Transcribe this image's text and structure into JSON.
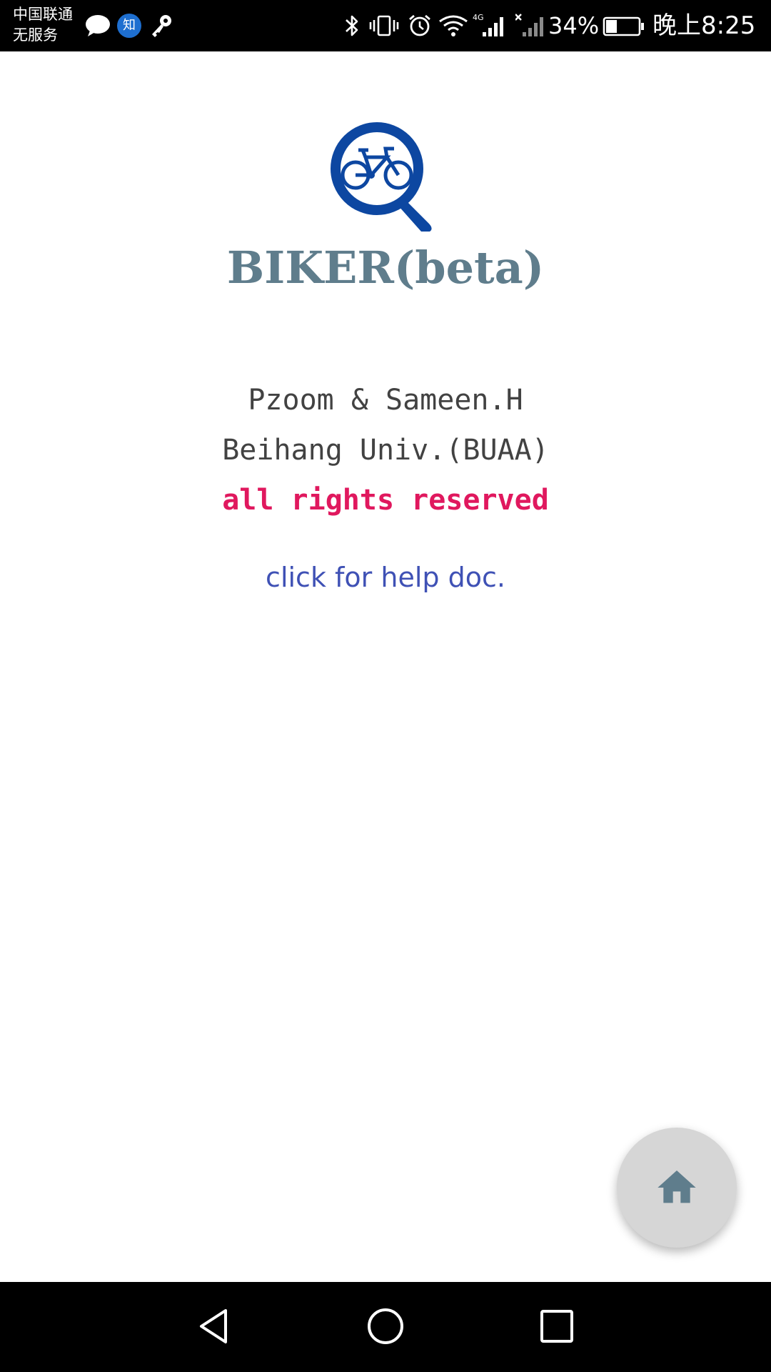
{
  "status_bar": {
    "carrier_line1": "中国联通",
    "carrier_line2": "无服务",
    "notification_icons": [
      "chat-bubble-icon",
      "zhihu-icon",
      "key-icon"
    ],
    "zhihu_label": "知",
    "system_icons": [
      "bluetooth-icon",
      "vibrate-icon",
      "alarm-icon",
      "wifi-icon",
      "signal-4g-icon",
      "signal-no-sim-icon",
      "battery-charging-icon"
    ],
    "signal_4g_label": "4G",
    "battery_percent": "34%",
    "battery_level": 0.34,
    "time": "晚上8:25"
  },
  "app": {
    "logo_icon": "bike-search-icon",
    "title": "BIKER(beta)",
    "authors": "Pzoom & Sameen.H",
    "university": "Beihang Univ.(BUAA)",
    "rights": "all rights reserved",
    "help_link": "click for help doc."
  },
  "fab": {
    "icon": "home-icon"
  },
  "navigation_bar": {
    "buttons": [
      "back-icon",
      "home-circle-icon",
      "recent-apps-icon"
    ]
  },
  "colors": {
    "status_bar_bg": "#000000",
    "logo_blue": "#0d47a1",
    "title": "#5f7d8c",
    "credits_text": "#424242",
    "rights": "#e0185e",
    "help_link": "#3f51b5",
    "fab_bg": "#d6d6d6",
    "fab_icon": "#5f7d8c",
    "nav_bar_bg": "#000000"
  }
}
